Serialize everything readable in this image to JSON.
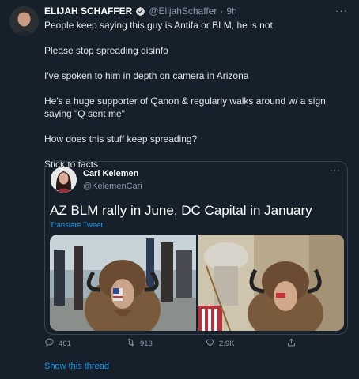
{
  "author": {
    "name": "ELIJAH SCHAFFER",
    "handle": "@ElijahSchaffer",
    "separator": "·",
    "time": "9h"
  },
  "body": {
    "paragraphs": [
      "People keep saying this guy is Antifa or BLM, he is not",
      "Please stop spreading disinfo",
      "I've spoken to him in depth on camera in Arizona",
      "He's a huge supporter of Qanon & regularly walks around w/ a sign saying \"Q sent me\"",
      "How does this stuff keep spreading?",
      "Stick to facts"
    ]
  },
  "quote": {
    "name": "Cari Kelemen",
    "handle": "@KelemenCari",
    "text": "AZ BLM rally in June, DC Capital in January",
    "translate": "Translate Tweet"
  },
  "actions": {
    "replies": "461",
    "retweets": "913",
    "likes": "2.9K"
  },
  "show_thread": "Show this thread",
  "colors": {
    "background": "#15202b",
    "accent": "#1d9bf0",
    "muted": "#8b98a5",
    "border": "#38444d"
  },
  "icons": {
    "verified": "verified-badge-icon",
    "more": "more-dots-icon",
    "reply": "reply-icon",
    "retweet": "retweet-icon",
    "like": "heart-icon",
    "share": "share-icon"
  }
}
